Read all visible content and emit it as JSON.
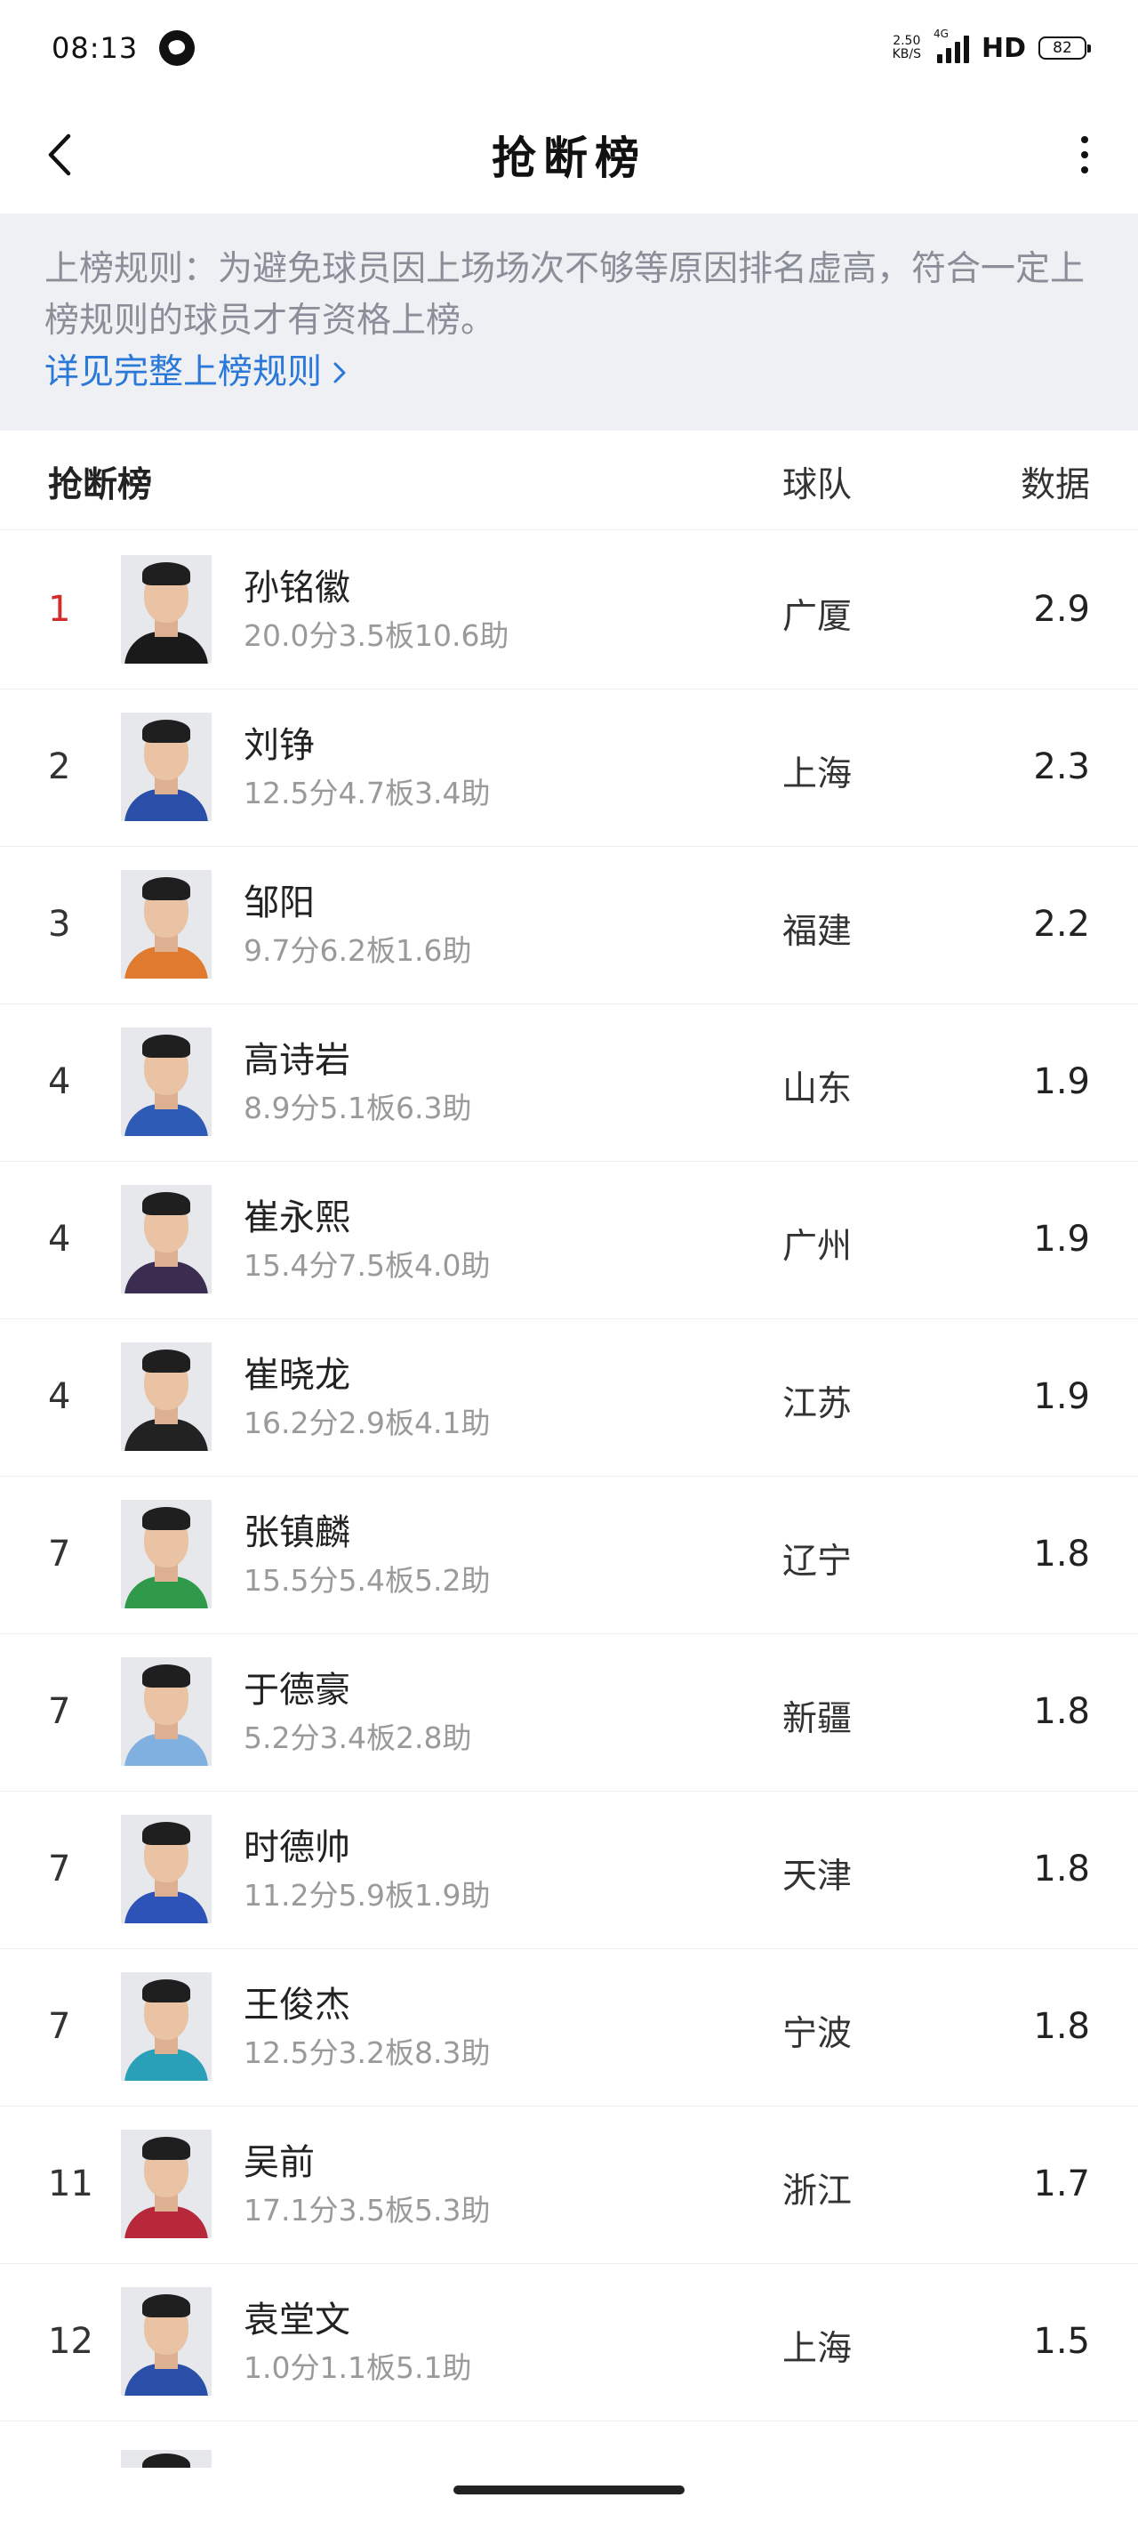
{
  "status_bar": {
    "time": "08:13",
    "net_speed_value": "2.50",
    "net_speed_unit": "KB/S",
    "network_type": "4G",
    "hd_label": "HD",
    "battery": "82"
  },
  "nav": {
    "title": "抢断榜"
  },
  "rule": {
    "text": "上榜规则：为避免球员因上场场次不够等原因排名虚高，符合一定上榜规则的球员才有资格上榜。",
    "link_label": "详见完整上榜规则"
  },
  "table": {
    "headers": {
      "title": "抢断榜",
      "team": "球队",
      "data": "数据"
    },
    "rows": [
      {
        "rank": "1",
        "name": "孙铭徽",
        "stats": "20.0分3.5板10.6助",
        "team": "广厦",
        "value": "2.9",
        "jersey_color": "#1a1a1a"
      },
      {
        "rank": "2",
        "name": "刘铮",
        "stats": "12.5分4.7板3.4助",
        "team": "上海",
        "value": "2.3",
        "jersey_color": "#2a4fa8"
      },
      {
        "rank": "3",
        "name": "邹阳",
        "stats": "9.7分6.2板1.6助",
        "team": "福建",
        "value": "2.2",
        "jersey_color": "#e07a2e"
      },
      {
        "rank": "4",
        "name": "高诗岩",
        "stats": "8.9分5.1板6.3助",
        "team": "山东",
        "value": "1.9",
        "jersey_color": "#2d5bb5"
      },
      {
        "rank": "4",
        "name": "崔永熙",
        "stats": "15.4分7.5板4.0助",
        "team": "广州",
        "value": "1.9",
        "jersey_color": "#3b2d4f"
      },
      {
        "rank": "4",
        "name": "崔晓龙",
        "stats": "16.2分2.9板4.1助",
        "team": "江苏",
        "value": "1.9",
        "jersey_color": "#222222"
      },
      {
        "rank": "7",
        "name": "张镇麟",
        "stats": "15.5分5.4板5.2助",
        "team": "辽宁",
        "value": "1.8",
        "jersey_color": "#2e9a4a"
      },
      {
        "rank": "7",
        "name": "于德豪",
        "stats": "5.2分3.4板2.8助",
        "team": "新疆",
        "value": "1.8",
        "jersey_color": "#7fb0df"
      },
      {
        "rank": "7",
        "name": "时德帅",
        "stats": "11.2分5.9板1.9助",
        "team": "天津",
        "value": "1.8",
        "jersey_color": "#2d52b8"
      },
      {
        "rank": "7",
        "name": "王俊杰",
        "stats": "12.5分3.2板8.3助",
        "team": "宁波",
        "value": "1.8",
        "jersey_color": "#2aa0b8"
      },
      {
        "rank": "11",
        "name": "吴前",
        "stats": "17.1分3.5板5.3助",
        "team": "浙江",
        "value": "1.7",
        "jersey_color": "#b6283a"
      },
      {
        "rank": "12",
        "name": "袁堂文",
        "stats": "1.0分1.1板5.1助",
        "team": "上海",
        "value": "1.5",
        "jersey_color": "#2a4fa8"
      }
    ]
  }
}
